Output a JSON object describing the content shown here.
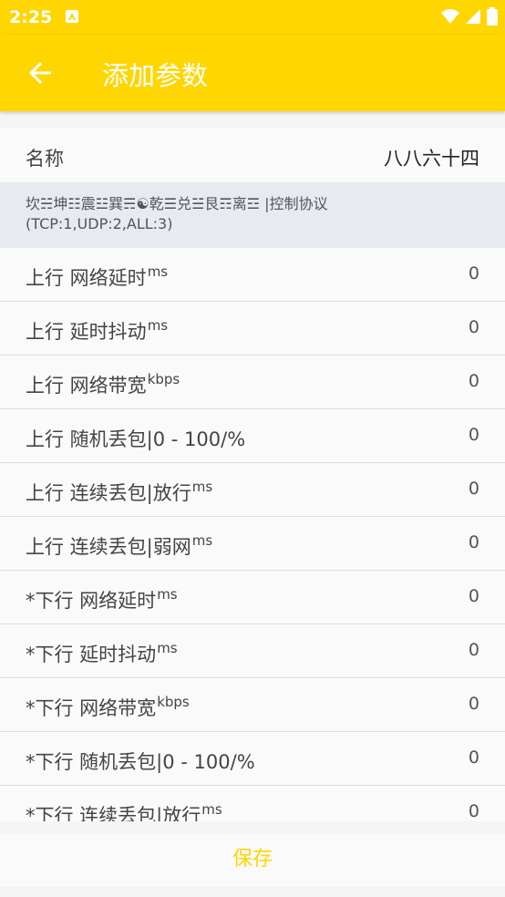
{
  "status_bar": {
    "time": "2:25"
  },
  "toolbar": {
    "title": "添加参数"
  },
  "name_field": {
    "label": "名称",
    "value": "八八六十四"
  },
  "protocol_info": "坎☵坤☷震☳巽☴☯乾☰兑☱艮☶离☲ |控制协议(TCP:1,UDP:2,ALL:3)",
  "params": [
    {
      "label": "上行 网络延时",
      "unit": "ms",
      "value": "0"
    },
    {
      "label": "上行 延时抖动",
      "unit": "ms",
      "value": "0"
    },
    {
      "label": "上行 网络带宽",
      "unit": "kbps",
      "value": "0"
    },
    {
      "label": "上行 随机丢包|0 - 100/%",
      "unit": "",
      "value": "0"
    },
    {
      "label": "上行 连续丢包|放行",
      "unit": "ms",
      "value": "0"
    },
    {
      "label": "上行 连续丢包|弱网",
      "unit": "ms",
      "value": "0"
    },
    {
      "label": "*下行 网络延时",
      "unit": "ms",
      "value": "0"
    },
    {
      "label": "*下行 延时抖动",
      "unit": "ms",
      "value": "0"
    },
    {
      "label": "*下行 网络带宽",
      "unit": "kbps",
      "value": "0"
    },
    {
      "label": "*下行 随机丢包|0 - 100/%",
      "unit": "",
      "value": "0"
    },
    {
      "label": "*下行 连续丢包|放行",
      "unit": "ms",
      "value": "0"
    }
  ],
  "save_label": "保存",
  "colors": {
    "accent": "#ffd600",
    "background": "#f5f5f5",
    "info_bg": "#e8eaf2"
  }
}
